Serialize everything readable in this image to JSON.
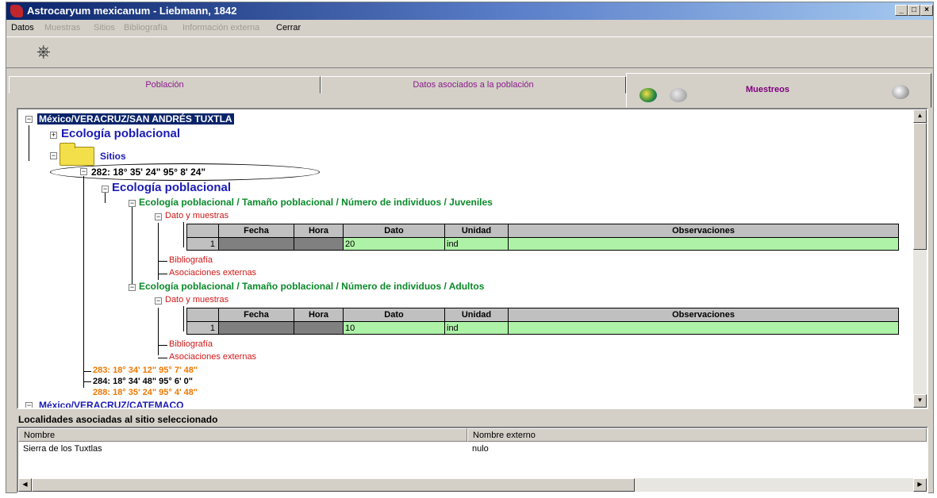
{
  "window": {
    "title": "Astrocaryum mexicanum - Liebmann, 1842",
    "controls": {
      "minimize": "_",
      "maximize": "□",
      "close": "×"
    }
  },
  "menu": [
    {
      "label": "Datos",
      "enabled": true
    },
    {
      "label": "Muestras",
      "enabled": false
    },
    {
      "label": "Sitios",
      "enabled": false
    },
    {
      "label": "Bibliografía",
      "enabled": false
    },
    {
      "label": "Información externa",
      "enabled": false
    },
    {
      "label": "Cerrar",
      "enabled": true
    }
  ],
  "toolbar": {
    "exit_icon": "exit-door-icon"
  },
  "tabs": [
    {
      "label": "Población"
    },
    {
      "label": "Datos asociados a la población"
    },
    {
      "label": "Muestreos",
      "active": true
    }
  ],
  "tree": {
    "root": "México/VERACRUZ/SAN ANDRÉS TUXTLA",
    "ecologia_top": "Ecología poblacional",
    "sitios": "Sitios",
    "site_282": "282: 18° 35' 24\" 95° 8' 24\"",
    "ecologia_site": "Ecología poblacional",
    "juveniles": {
      "label": "Ecología poblacional / Tamaño poblacional / Número de individuos / Juveniles",
      "dato_y_muestras": "Dato y muestras",
      "columns": [
        "",
        "Fecha",
        "Hora",
        "Dato",
        "Unidad",
        "Observaciones"
      ],
      "rows": [
        {
          "n": "1",
          "fecha": "",
          "hora": "",
          "dato": "20",
          "unidad": "ind",
          "obs": ""
        }
      ],
      "bibliografia": "Bibliografía",
      "asociaciones": "Asociaciones externas"
    },
    "adultos": {
      "label": "Ecología poblacional / Tamaño poblacional / Número de individuos / Adultos",
      "dato_y_muestras": "Dato y muestras",
      "columns": [
        "",
        "Fecha",
        "Hora",
        "Dato",
        "Unidad",
        "Observaciones"
      ],
      "rows": [
        {
          "n": "1",
          "fecha": "",
          "hora": "",
          "dato": "10",
          "unidad": "ind",
          "obs": ""
        }
      ],
      "bibliografia": "Bibliografía",
      "asociaciones": "Asociaciones externas"
    },
    "site_283": "283: 18° 34' 12\" 95° 7' 48\"",
    "site_284": "284: 18° 34' 48\" 95° 6' 0\"",
    "site_288": "288: 18° 35' 24\" 95° 4' 48\"",
    "next_root": "México/VERACRUZ/CATEMACO"
  },
  "localidades": {
    "title": "Localidades asociadas al sitio seleccionado",
    "columns": [
      "Nombre",
      "Nombre externo"
    ],
    "rows": [
      {
        "nombre": "Sierra de los Tuxtlas",
        "externo": "nulo"
      }
    ]
  },
  "colors": {
    "title_gradient_start": "#0a246a",
    "tab_text": "#800080",
    "tree_blue": "#1c1cb4",
    "tree_green": "#0a8a2a",
    "tree_red": "#d01818",
    "tree_orange": "#f07800",
    "cell_green": "#aef2a8"
  }
}
